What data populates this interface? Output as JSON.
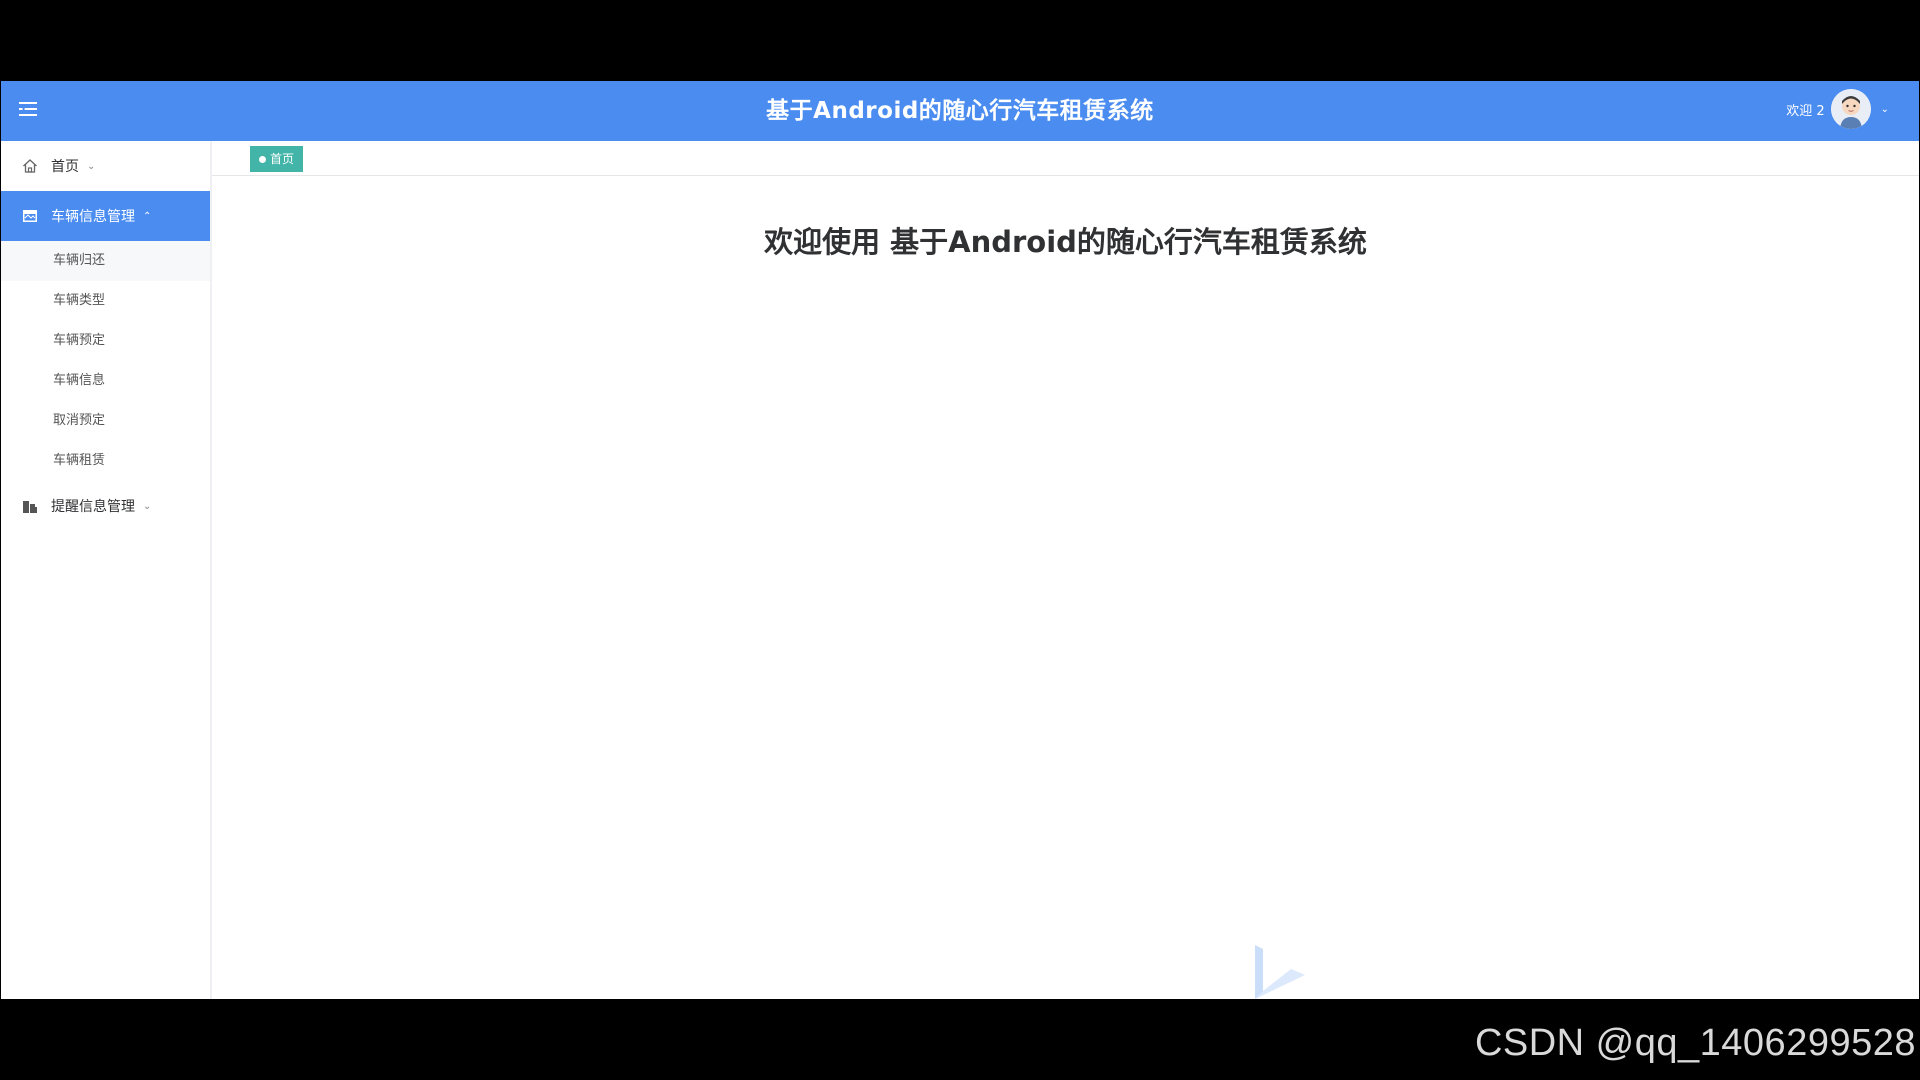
{
  "header": {
    "title": "基于Android的随心行汽车租赁系统",
    "welcome_text": "欢迎 2",
    "menu_icon": "hamburger-menu-icon",
    "avatar_icon": "user-avatar",
    "background_color": "#4a8cf0"
  },
  "sidebar": {
    "items": [
      {
        "label": "首页",
        "icon": "home-icon",
        "expanded": false
      },
      {
        "label": "车辆信息管理",
        "icon": "calendar-icon",
        "expanded": true,
        "active": true
      },
      {
        "label": "提醒信息管理",
        "icon": "building-icon",
        "expanded": false
      }
    ],
    "submenu": [
      "车辆归还",
      "车辆类型",
      "车辆预定",
      "车辆信息",
      "取消预定",
      "车辆租赁"
    ]
  },
  "tags": [
    {
      "label": "首页",
      "color": "#42b4a8"
    }
  ],
  "main": {
    "welcome_heading": "欢迎使用 基于Android的随心行汽车租赁系统"
  },
  "watermark": "CSDN @qq_1406299528"
}
